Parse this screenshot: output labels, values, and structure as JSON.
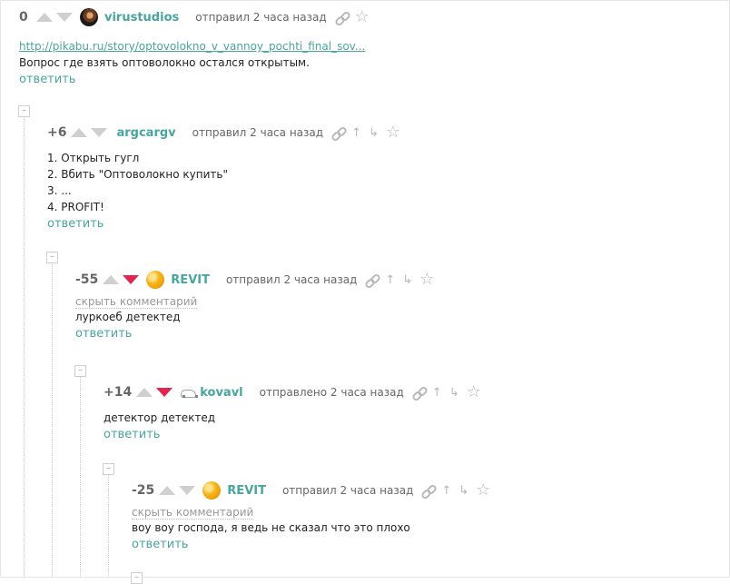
{
  "comments": [
    {
      "rating": "0",
      "username": "virustudios",
      "meta": "отправил 2 часа назад",
      "link": "http://pikabu.ru/story/optovolokno_v_vannoy_pochti_final_sov...",
      "lines": [
        "Вопрос где взять оптоволокно остался открытым."
      ],
      "reply": "ответить"
    },
    {
      "rating": "+6",
      "username": "argcargv",
      "meta": "отправил 2 часа назад",
      "lines": [
        "1. Открыть гугл",
        "2. Вбить \"Оптоволокно купить\"",
        "3. ...",
        "4. PROFIT!"
      ],
      "reply": "ответить"
    },
    {
      "rating": "-55",
      "username": "REVIT",
      "meta": "отправил 2 часа назад",
      "hide": "скрыть комментарий",
      "lines": [
        "луркоеб детектед"
      ],
      "reply": "ответить"
    },
    {
      "rating": "+14",
      "username": "kovavl",
      "meta": "отправлено 2 часа назад",
      "lines": [
        "детектор детектед"
      ],
      "reply": "ответить"
    },
    {
      "rating": "-25",
      "username": "REVIT",
      "meta": "отправил 2 часа назад",
      "hide": "скрыть комментарий",
      "lines": [
        "воу воу господа, я ведь не сказал что это плохо"
      ],
      "reply": "ответить"
    }
  ],
  "icons": {
    "link": "link-icon",
    "up": "arrow-up-icon",
    "down": "arrow-down-icon",
    "star": "star-icon"
  },
  "colors": {
    "accent": "#48a5a0",
    "downvote_active": "#e0264f",
    "muted": "#cfcfcf"
  },
  "collapse_symbol": "–"
}
